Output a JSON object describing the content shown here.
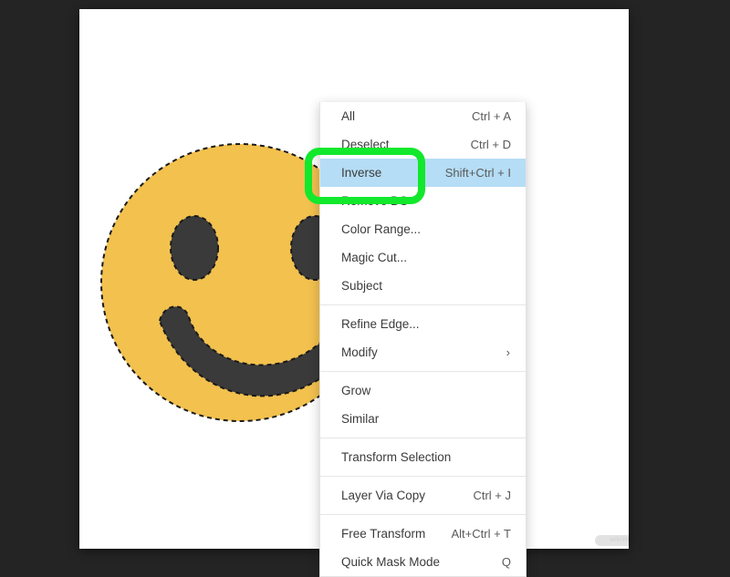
{
  "app": {
    "canvas_background_color": "#242424",
    "document_background_color": "#ffffff"
  },
  "canvas": {
    "watermark_label": "wikiHow",
    "artwork": {
      "name": "smiley-face",
      "face_color": "#F2C14E",
      "feature_color": "#3A3A3A",
      "selection_outline": "marching-ants-dashed"
    }
  },
  "context_menu": {
    "name": "selection-context-menu",
    "highlight_color": "#b5ddf5",
    "items": [
      {
        "label": "All",
        "shortcut": "Ctrl + A",
        "submenu": false,
        "highlighted": false
      },
      {
        "label": "Deselect",
        "shortcut": "Ctrl + D",
        "submenu": false,
        "highlighted": false
      },
      {
        "label": "Inverse",
        "shortcut": "Shift+Ctrl + I",
        "submenu": false,
        "highlighted": true
      },
      {
        "label": "Remove BG",
        "shortcut": "",
        "submenu": false,
        "highlighted": false
      },
      {
        "label": "Color Range...",
        "shortcut": "",
        "submenu": false,
        "highlighted": false
      },
      {
        "label": "Magic Cut...",
        "shortcut": "",
        "submenu": false,
        "highlighted": false
      },
      {
        "label": "Subject",
        "shortcut": "",
        "submenu": false,
        "highlighted": false
      },
      {
        "label": "Refine Edge...",
        "shortcut": "",
        "submenu": false,
        "highlighted": false
      },
      {
        "label": "Modify",
        "shortcut": "",
        "submenu": true,
        "submenu_glyph": "›",
        "highlighted": false
      },
      {
        "label": "Grow",
        "shortcut": "",
        "submenu": false,
        "highlighted": false
      },
      {
        "label": "Similar",
        "shortcut": "",
        "submenu": false,
        "highlighted": false
      },
      {
        "label": "Transform Selection",
        "shortcut": "",
        "submenu": false,
        "highlighted": false
      },
      {
        "label": "Layer Via Copy",
        "shortcut": "Ctrl + J",
        "submenu": false,
        "highlighted": false
      },
      {
        "label": "Free Transform",
        "shortcut": "Alt+Ctrl + T",
        "submenu": false,
        "highlighted": false
      },
      {
        "label": "Quick Mask Mode",
        "shortcut": "Q",
        "submenu": false,
        "highlighted": false
      }
    ],
    "separators_after": [
      6,
      8,
      10,
      11,
      12
    ]
  },
  "annotation": {
    "name": "highlight-box",
    "target_label": "Inverse",
    "color": "#12e82c"
  }
}
